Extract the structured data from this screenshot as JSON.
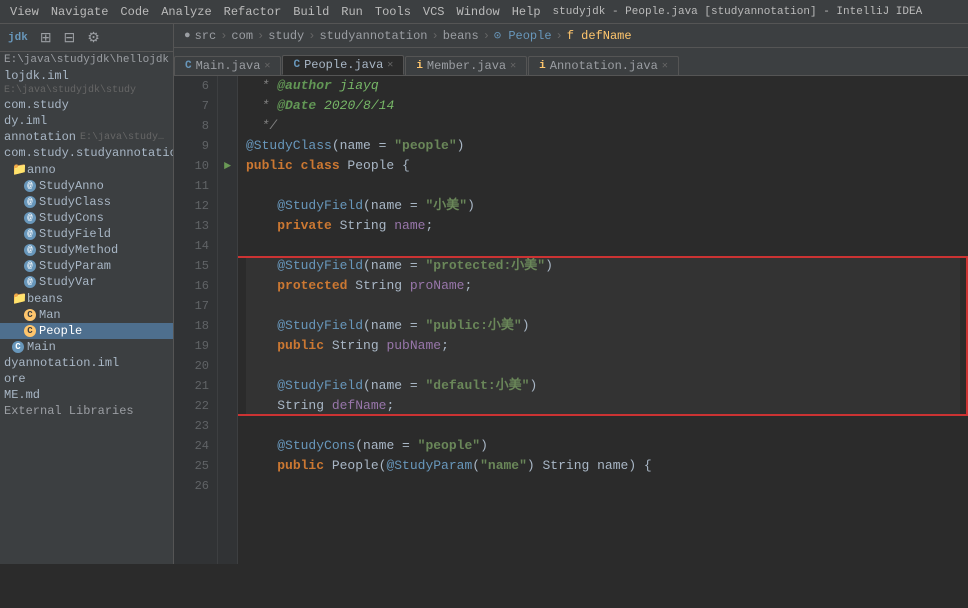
{
  "window": {
    "title": "studyjdk - People.java [studyannotation] - IntelliJ IDEA"
  },
  "menubar": {
    "items": [
      "View",
      "Navigate",
      "Code",
      "Analyze",
      "Refactor",
      "Build",
      "Run",
      "Tools",
      "VCS",
      "Window",
      "Help"
    ]
  },
  "breadcrumb": {
    "parts": [
      "src",
      "com",
      "study",
      "studyannotation",
      "beans",
      "People",
      "defName"
    ]
  },
  "tabs": [
    {
      "label": "Main.java",
      "type": "c",
      "active": false
    },
    {
      "label": "People.java",
      "type": "c",
      "active": true
    },
    {
      "label": "Member.java",
      "type": "i",
      "active": false
    },
    {
      "label": "Annotation.java",
      "type": "i",
      "active": false
    }
  ],
  "sidebar": {
    "toolbar_buttons": [
      "expand",
      "collapse",
      "settings"
    ],
    "project_label": "jdk",
    "project_path": "E:\\java\\studyjdk\\hellojdk",
    "items": [
      {
        "level": 0,
        "label": "lojdk.iml",
        "sub": "E:\\java\\studyjdk\\study",
        "indent": 0
      },
      {
        "level": 1,
        "label": "com.study",
        "indent": 0
      },
      {
        "level": 1,
        "label": "dy.iml",
        "indent": 0
      },
      {
        "level": 1,
        "label": "annotation",
        "sub": "E:\\java\\studyjdk\\stu",
        "indent": 0
      },
      {
        "level": 2,
        "label": "com.study.studyannotation",
        "indent": 0
      },
      {
        "level": 3,
        "label": "anno",
        "folder": true,
        "indent": 1
      },
      {
        "level": 4,
        "label": "StudyAnno",
        "anno": true,
        "indent": 2
      },
      {
        "level": 4,
        "label": "StudyClass",
        "anno": true,
        "indent": 2
      },
      {
        "level": 4,
        "label": "StudyCons",
        "anno": true,
        "indent": 2
      },
      {
        "level": 4,
        "label": "StudyField",
        "anno": true,
        "indent": 2
      },
      {
        "level": 4,
        "label": "StudyMethod",
        "anno": true,
        "indent": 2
      },
      {
        "level": 4,
        "label": "StudyParam",
        "anno": true,
        "indent": 2
      },
      {
        "level": 4,
        "label": "StudyVar",
        "anno": true,
        "indent": 2
      },
      {
        "level": 3,
        "label": "beans",
        "folder": true,
        "indent": 1
      },
      {
        "level": 4,
        "label": "Man",
        "class": true,
        "indent": 2
      },
      {
        "level": 4,
        "label": "People",
        "class": true,
        "indent": 2,
        "selected": true
      },
      {
        "level": 3,
        "label": "Main",
        "class": true,
        "indent": 1
      },
      {
        "level": 2,
        "label": "dyannotation.iml",
        "indent": 0
      },
      {
        "level": 2,
        "label": "ore",
        "indent": 0
      },
      {
        "level": 2,
        "label": "ME.md",
        "indent": 0
      },
      {
        "level": 2,
        "label": "External Libraries",
        "indent": 0
      }
    ]
  },
  "code": {
    "lines": [
      {
        "num": 6,
        "gutter": "",
        "tokens": [
          {
            "t": "comment",
            "v": "  * "
          },
          {
            "t": "javadoc-tag",
            "v": "@author"
          },
          {
            "t": "javadoc-val",
            "v": " jiayq"
          }
        ]
      },
      {
        "num": 7,
        "gutter": "",
        "tokens": [
          {
            "t": "comment",
            "v": "  * "
          },
          {
            "t": "javadoc-tag",
            "v": "@Date"
          },
          {
            "t": "javadoc-val",
            "v": " 2020/8/14"
          }
        ]
      },
      {
        "num": 8,
        "gutter": "",
        "tokens": [
          {
            "t": "comment",
            "v": "  */"
          }
        ]
      },
      {
        "num": 9,
        "gutter": "",
        "tokens": [
          {
            "t": "ann",
            "v": "@StudyClass"
          },
          {
            "t": "plain",
            "v": "("
          },
          {
            "t": "plain",
            "v": "name = "
          },
          {
            "t": "str",
            "v": "\"people\""
          },
          {
            "t": "plain",
            "v": ")"
          }
        ]
      },
      {
        "num": 10,
        "gutter": "►",
        "tokens": [
          {
            "t": "kw",
            "v": "public class"
          },
          {
            "t": "plain",
            "v": " People {"
          }
        ]
      },
      {
        "num": 11,
        "gutter": "",
        "tokens": []
      },
      {
        "num": 12,
        "gutter": "",
        "tokens": [
          {
            "t": "plain",
            "v": "    "
          },
          {
            "t": "ann",
            "v": "@StudyField"
          },
          {
            "t": "plain",
            "v": "("
          },
          {
            "t": "plain",
            "v": "name = "
          },
          {
            "t": "str-zh",
            "v": "\"小美\""
          },
          {
            "t": "plain",
            "v": ")"
          }
        ]
      },
      {
        "num": 13,
        "gutter": "",
        "tokens": [
          {
            "t": "plain",
            "v": "    "
          },
          {
            "t": "kw",
            "v": "private"
          },
          {
            "t": "plain",
            "v": " String "
          },
          {
            "t": "field",
            "v": "name"
          },
          {
            "t": "plain",
            "v": ";"
          }
        ]
      },
      {
        "num": 14,
        "gutter": "",
        "tokens": []
      },
      {
        "num": 15,
        "gutter": "",
        "tokens": [
          {
            "t": "plain",
            "v": "    "
          },
          {
            "t": "ann",
            "v": "@StudyField"
          },
          {
            "t": "plain",
            "v": "("
          },
          {
            "t": "plain",
            "v": "name = "
          },
          {
            "t": "str-zh",
            "v": "\"protected:小美\""
          },
          {
            "t": "plain",
            "v": ")"
          }
        ],
        "highlight": true
      },
      {
        "num": 16,
        "gutter": "",
        "tokens": [
          {
            "t": "plain",
            "v": "    "
          },
          {
            "t": "kw",
            "v": "protected"
          },
          {
            "t": "plain",
            "v": " String "
          },
          {
            "t": "field",
            "v": "proName"
          },
          {
            "t": "plain",
            "v": ";"
          }
        ],
        "highlight": true
      },
      {
        "num": 17,
        "gutter": "",
        "tokens": [],
        "highlight": true
      },
      {
        "num": 18,
        "gutter": "",
        "tokens": [
          {
            "t": "plain",
            "v": "    "
          },
          {
            "t": "ann",
            "v": "@StudyField"
          },
          {
            "t": "plain",
            "v": "("
          },
          {
            "t": "plain",
            "v": "name = "
          },
          {
            "t": "str-zh",
            "v": "\"public:小美\""
          },
          {
            "t": "plain",
            "v": ")"
          }
        ],
        "highlight": true
      },
      {
        "num": 19,
        "gutter": "",
        "tokens": [
          {
            "t": "plain",
            "v": "    "
          },
          {
            "t": "kw",
            "v": "public"
          },
          {
            "t": "plain",
            "v": " String "
          },
          {
            "t": "field",
            "v": "pubName"
          },
          {
            "t": "plain",
            "v": ";"
          }
        ],
        "highlight": true
      },
      {
        "num": 20,
        "gutter": "",
        "tokens": [],
        "highlight": true
      },
      {
        "num": 21,
        "gutter": "",
        "tokens": [
          {
            "t": "plain",
            "v": "    "
          },
          {
            "t": "ann",
            "v": "@StudyField"
          },
          {
            "t": "plain",
            "v": "("
          },
          {
            "t": "plain",
            "v": "name = "
          },
          {
            "t": "str-zh",
            "v": "\"default:小美\""
          },
          {
            "t": "plain",
            "v": ")"
          }
        ],
        "highlight": true
      },
      {
        "num": 22,
        "gutter": "",
        "tokens": [
          {
            "t": "plain",
            "v": "    "
          },
          {
            "t": "plain",
            "v": "String "
          },
          {
            "t": "field",
            "v": "defName"
          },
          {
            "t": "plain",
            "v": ";"
          }
        ],
        "highlight": true
      },
      {
        "num": 23,
        "gutter": "",
        "tokens": []
      },
      {
        "num": 24,
        "gutter": "",
        "tokens": [
          {
            "t": "plain",
            "v": "    "
          },
          {
            "t": "ann",
            "v": "@StudyCons"
          },
          {
            "t": "plain",
            "v": "("
          },
          {
            "t": "plain",
            "v": "name = "
          },
          {
            "t": "str",
            "v": "\"people\""
          },
          {
            "t": "plain",
            "v": ")"
          }
        ]
      },
      {
        "num": 25,
        "gutter": "",
        "tokens": [
          {
            "t": "plain",
            "v": "    "
          },
          {
            "t": "kw",
            "v": "public"
          },
          {
            "t": "plain",
            "v": " People("
          },
          {
            "t": "ann",
            "v": "@StudyParam"
          },
          {
            "t": "plain",
            "v": "("
          },
          {
            "t": "str",
            "v": "\"name\""
          },
          {
            "t": "plain",
            "v": ") String name) {"
          }
        ]
      },
      {
        "num": 26,
        "gutter": "",
        "tokens": []
      }
    ]
  },
  "status": {
    "text": "External Libraries"
  }
}
